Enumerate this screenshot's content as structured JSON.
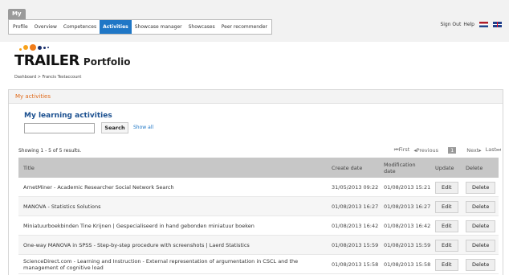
{
  "topbar": {
    "my_tab": "My",
    "nav": [
      "Profile",
      "Overview",
      "Competences",
      "Activities",
      "Showcase manager",
      "Showcases",
      "Peer recommender"
    ],
    "active": "Activities",
    "sign_out": "Sign Out",
    "help": "Help"
  },
  "logo": {
    "main": "TRAILER",
    "sub": "Portfolio"
  },
  "breadcrumb": "Dashboard > Francis Testaccount",
  "panel": {
    "title": "My activities"
  },
  "section": {
    "title": "My learning activities",
    "search_value": "",
    "search_button": "Search",
    "show_all": "Show all"
  },
  "results": "Showing 1 - 5 of 5 results.",
  "pager": {
    "first": "⏮First",
    "previous": "◂Previous",
    "page": "1",
    "next": "Next▸",
    "last": "Last⏭"
  },
  "table": {
    "headers": {
      "title": "Title",
      "create": "Create date",
      "modified": "Modification date",
      "update": "Update",
      "delete": "Delete"
    },
    "rows": [
      {
        "title": "ArnetMiner - Academic Researcher Social Network Search",
        "create": "31/05/2013 09:22",
        "modified": "01/08/2013 15:21",
        "edit": "Edit",
        "delete": "Delete"
      },
      {
        "title": "MANOVA - Statistics Solutions",
        "create": "01/08/2013 16:27",
        "modified": "01/08/2013 16:27",
        "edit": "Edit",
        "delete": "Delete"
      },
      {
        "title": "Miniatuurboekbinden Tine Krijnen | Gespecialiseerd in hand gebonden miniatuur boeken",
        "create": "01/08/2013 16:42",
        "modified": "01/08/2013 16:42",
        "edit": "Edit",
        "delete": "Delete"
      },
      {
        "title": "One-way MANOVA in SPSS - Step-by-step procedure with screenshots | Laerd Statistics",
        "create": "01/08/2013 15:59",
        "modified": "01/08/2013 15:59",
        "edit": "Edit",
        "delete": "Delete"
      },
      {
        "title": "ScienceDirect.com - Learning and Instruction - External representation of argumentation in CSCL and the management of cognitive load",
        "create": "01/08/2013 15:58",
        "modified": "01/08/2013 15:58",
        "edit": "Edit",
        "delete": "Delete"
      }
    ]
  },
  "colors": {
    "accent": "#1f77c6",
    "panel_title": "#e06a1a",
    "heading": "#1a4f8f",
    "table_header": "#c7c7c7"
  }
}
